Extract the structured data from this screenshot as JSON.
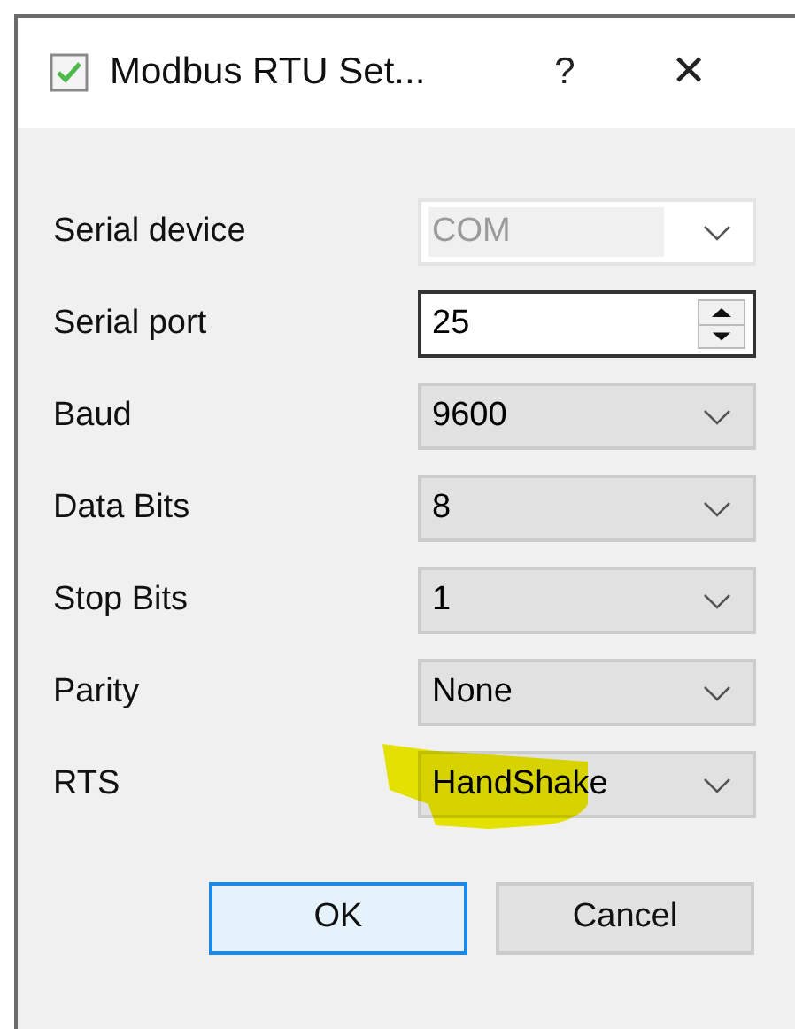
{
  "window": {
    "title": "Modbus RTU Set...",
    "help": "?",
    "close": "✕"
  },
  "fields": [
    {
      "label": "Serial device",
      "kind": "combo",
      "value": "COM",
      "disabled": true,
      "highlighted": false
    },
    {
      "label": "Serial port",
      "kind": "spin",
      "value": "25",
      "disabled": false,
      "highlighted": false
    },
    {
      "label": "Baud",
      "kind": "combo",
      "value": "9600",
      "disabled": false,
      "highlighted": false
    },
    {
      "label": "Data Bits",
      "kind": "combo",
      "value": "8",
      "disabled": false,
      "highlighted": false
    },
    {
      "label": "Stop Bits",
      "kind": "combo",
      "value": "1",
      "disabled": false,
      "highlighted": false
    },
    {
      "label": "Parity",
      "kind": "combo",
      "value": "None",
      "disabled": false,
      "highlighted": false
    },
    {
      "label": "RTS",
      "kind": "combo",
      "value": "HandShake",
      "disabled": false,
      "highlighted": true
    }
  ],
  "buttons": [
    {
      "label": "OK",
      "default": true
    },
    {
      "label": "Cancel",
      "default": false
    }
  ]
}
